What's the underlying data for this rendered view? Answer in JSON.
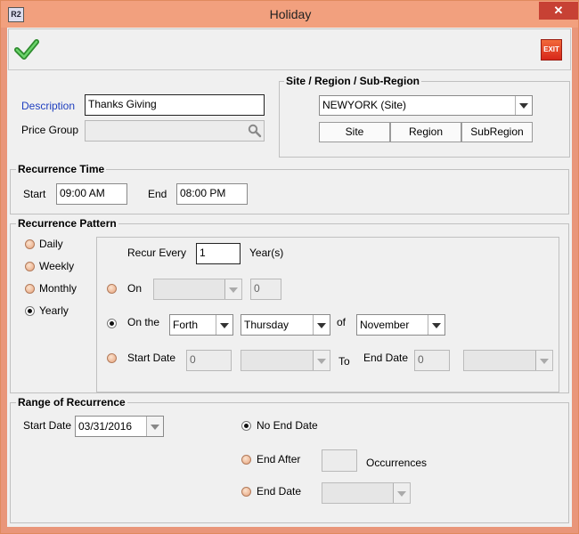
{
  "window": {
    "title": "Holiday",
    "app_icon": "R2",
    "close_glyph": "✕"
  },
  "toolbar": {
    "save_icon": "checkmark-icon",
    "exit_label": "EXIT"
  },
  "description": {
    "label": "Description",
    "value": "Thanks Giving"
  },
  "price_group": {
    "label": "Price Group",
    "value": ""
  },
  "site_region": {
    "legend": "Site / Region / Sub-Region",
    "selected": "NEWYORK (Site)",
    "site_button": "Site",
    "region_button": "Region",
    "subregion_button": "SubRegion"
  },
  "recurrence_time": {
    "legend": "Recurrence Time",
    "start_label": "Start",
    "start_value": "09:00 AM",
    "end_label": "End",
    "end_value": "08:00 PM"
  },
  "recurrence_pattern": {
    "legend": "Recurrence Pattern",
    "daily": "Daily",
    "weekly": "Weekly",
    "monthly": "Monthly",
    "yearly": "Yearly",
    "selected": "Yearly",
    "recur_every_label": "Recur Every",
    "recur_every_value": "1",
    "recur_unit": "Year(s)",
    "on_label": "On",
    "on_day_value": "0",
    "on_the_label": "On the",
    "ordinal": "Forth",
    "weekday": "Thursday",
    "of_label": "of",
    "month": "November",
    "start_date_label": "Start Date",
    "start_date_value": "0",
    "to_label": "To",
    "end_date_label": "End Date",
    "end_date_value": "0"
  },
  "range": {
    "legend": "Range of Recurrence",
    "start_date_label": "Start Date",
    "start_date_value": "03/31/2016",
    "no_end_label": "No End Date",
    "end_after_label": "End After",
    "occurrences_label": "Occurrences",
    "end_date_label": "End Date",
    "selected": "No End Date"
  }
}
